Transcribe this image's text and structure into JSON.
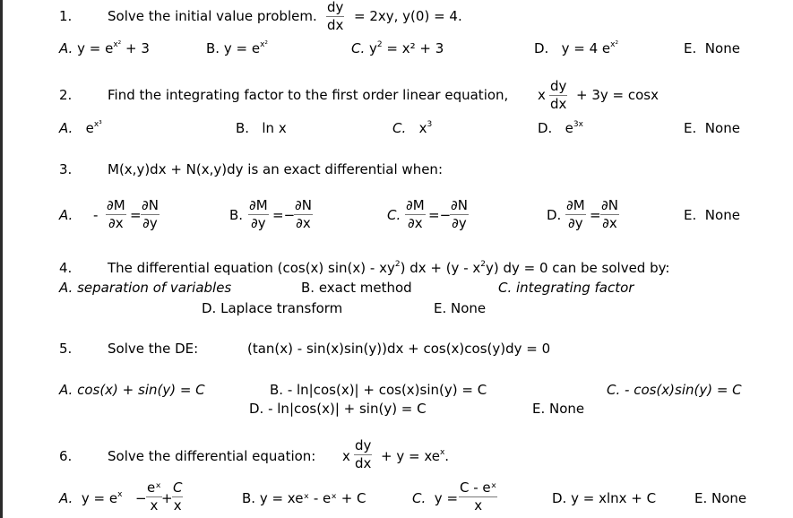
{
  "q1": {
    "number": "1.",
    "text": "Solve the initial value problem.",
    "eq_num": "dy",
    "eq_den": "dx",
    "eq_rhs": "= 2xy,  y(0) = 4.",
    "options": {
      "A": {
        "label": "A.",
        "pre": "y = e",
        "sup": "x²",
        "post": " + 3"
      },
      "B": {
        "label": "B.",
        "pre": "y = e",
        "sup": "x²",
        "post": ""
      },
      "C": {
        "label": "C.",
        "pre": "y",
        "sup": "2",
        "post": " = x² + 3"
      },
      "D": {
        "label": "D.",
        "pre": "y = 4 e",
        "sup": "x²",
        "post": ""
      },
      "E": {
        "label": "E.",
        "text": "None"
      }
    }
  },
  "q2": {
    "number": "2.",
    "text": "Find the integrating factor to the first order linear equation,",
    "eq_x": "x",
    "eq_num": "dy",
    "eq_den": "dx",
    "eq_rhs": "+ 3y = cosx",
    "options": {
      "A": {
        "label": "A.",
        "pre": "e",
        "sup": "x³"
      },
      "B": {
        "label": "B.",
        "text": "ln x"
      },
      "C": {
        "label": "C.",
        "pre": "x",
        "sup": "3"
      },
      "D": {
        "label": "D.",
        "pre": "e",
        "sup": "3x"
      },
      "E": {
        "label": "E.",
        "text": "None"
      }
    }
  },
  "q3": {
    "number": "3.",
    "text": "M(x,y)dx + N(x,y)dy is an exact differential when:",
    "options": {
      "A": {
        "label": "A.",
        "sign": "-",
        "n1": "∂M",
        "d1": "∂x",
        "mid": "=",
        "n2": "∂N",
        "d2": "∂y"
      },
      "B": {
        "label": "B.",
        "n1": "∂M",
        "d1": "∂y",
        "mid": "=−",
        "n2": "∂N",
        "d2": "∂x"
      },
      "C": {
        "label": "C.",
        "n1": "∂M",
        "d1": "∂x",
        "mid": "=−",
        "n2": "∂N",
        "d2": "∂y"
      },
      "D": {
        "label": "D.",
        "n1": "∂M",
        "d1": "∂y",
        "mid": "=",
        "n2": "∂N",
        "d2": "∂x"
      },
      "E": {
        "label": "E.",
        "text": "None"
      }
    }
  },
  "q4": {
    "number": "4.",
    "text_pre": "The differential equation (cos(x) sin(x) - xy",
    "sup1": "2",
    "text_mid": ") dx + (y - x",
    "sup2": "2",
    "text_post": "y) dy = 0 can be solved by:",
    "options": {
      "A": "A.  separation of variables",
      "B": "B.  exact method",
      "C": "C. integrating factor",
      "D": "D. Laplace transform",
      "E": "E.   None"
    }
  },
  "q5": {
    "number": "5.",
    "text": "Solve the DE:",
    "equation": "(tan(x) -  sin(x)sin(y))dx  +  cos(x)cos(y)dy = 0",
    "options": {
      "A": "A.  cos(x) + sin(y) = C",
      "B": "B.  - ln|cos(x)| + cos(x)sin(y) = C",
      "C": "C.  - cos(x)sin(y) = C",
      "D": "D.  - ln|cos(x)|  + sin(y) = C",
      "E": "E. None"
    }
  },
  "q6": {
    "number": "6.",
    "text": "Solve the differential equation:",
    "eq_x": "x",
    "eq_num": "dy",
    "eq_den": "dx",
    "eq_rhs_pre": "+ y = xe",
    "eq_rhs_sup": "x",
    "eq_rhs_post": ".",
    "options": {
      "A": {
        "label": "A.",
        "pre": "y = e",
        "sup": "x",
        "minus": "−",
        "n1": "eˣ",
        "d1": "x",
        "plus": "+",
        "n2": "C",
        "d2": "x"
      },
      "B": {
        "label": "B.",
        "text": "B. y = xeˣ - eˣ + C"
      },
      "C": {
        "label": "C.",
        "pre": "y =",
        "num": "C - eˣ",
        "den": "x"
      },
      "D": {
        "label": "D.",
        "text": "D.  y = xlnx + C"
      },
      "E": {
        "label": "E.",
        "text": "E.  None"
      }
    }
  }
}
